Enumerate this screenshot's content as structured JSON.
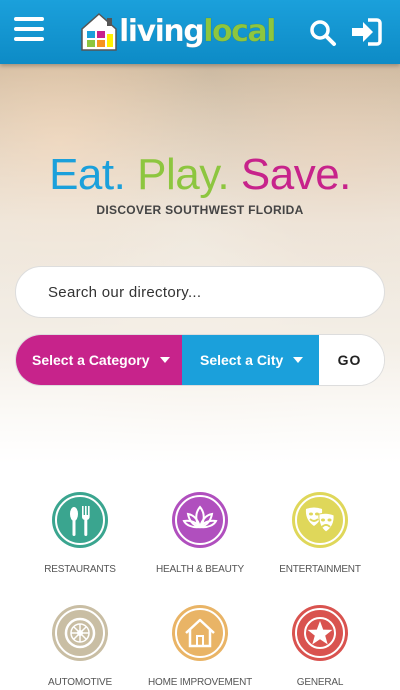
{
  "header": {
    "logo_part1": "living",
    "logo_part2": "local",
    "menu_icon": "hamburger-menu-icon",
    "search_icon": "search-icon",
    "login_icon": "sign-in-icon"
  },
  "hero": {
    "tagline_eat": "Eat.",
    "tagline_play": "Play.",
    "tagline_save": "Save.",
    "subtitle": "DISCOVER SOUTHWEST FLORIDA"
  },
  "search": {
    "placeholder": "Search our directory...",
    "category_label": "Select a Category",
    "city_label": "Select a City",
    "go_label": "GO"
  },
  "categories": [
    {
      "label": "RESTAURANTS",
      "icon": "fork-knife-icon",
      "color": "#3aa58f"
    },
    {
      "label": "HEALTH & BEAUTY",
      "icon": "lotus-icon",
      "color": "#b04fbe"
    },
    {
      "label": "ENTERTAINMENT",
      "icon": "theater-masks-icon",
      "color": "#dfd75a"
    },
    {
      "label": "AUTOMOTIVE",
      "icon": "wheel-icon",
      "color": "#c9bea4"
    },
    {
      "label": "HOME IMPROVEMENT",
      "icon": "house-icon",
      "color": "#e9b466"
    },
    {
      "label": "GENERAL",
      "icon": "star-icon",
      "color": "#d9534f"
    }
  ],
  "colors": {
    "header_blue": "#1ba0db",
    "brand_green": "#8dc63f",
    "brand_magenta": "#c7238b"
  }
}
